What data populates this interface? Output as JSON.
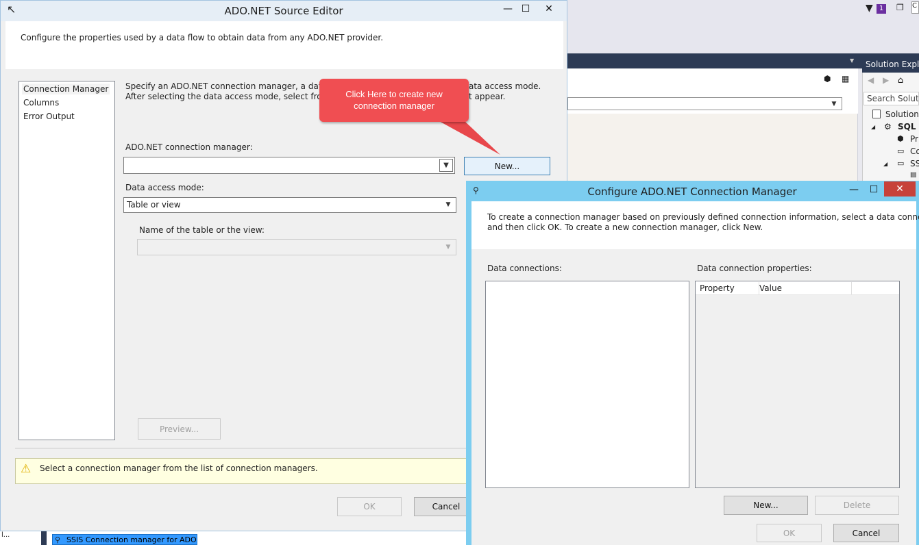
{
  "background_ide": {
    "solution_explorer_title": "Solution Explor",
    "search_placeholder": "Search Solution",
    "tree": [
      "Solution '",
      "SQL S",
      "Pr",
      "Co",
      "SS"
    ],
    "filter_badge": "1",
    "top_right_char": "C",
    "taskbar_item": "SSIS Connection manager for ADO.NET",
    "taskbar_left": "l..."
  },
  "source_editor": {
    "title": "ADO.NET Source Editor",
    "description": "Configure the properties used by a data flow to obtain data from any ADO.NET provider.",
    "nav_items": [
      "Connection Manager",
      "Columns",
      "Error Output"
    ],
    "instructions_line1": "Specify an ADO.NET connection manager, a data sour",
    "instructions_line1_end": "ata access mode.",
    "instructions_line2": "After selecting the data access mode, select from amo",
    "instructions_line2_end": "t appear.",
    "conn_label": "ADO.NET connection manager:",
    "conn_value": "",
    "new_button": "New...",
    "access_label": "Data access mode:",
    "access_value": "Table or view",
    "table_label": "Name of the table or the view:",
    "table_value": "",
    "preview_button": "Preview...",
    "warning": "Select a connection manager from the list of connection managers.",
    "ok_button": "OK",
    "cancel_button": "Cancel"
  },
  "callout": {
    "text_line1": "Click Here to create new",
    "text_line2": "connection manager"
  },
  "conn_dialog": {
    "title": "Configure ADO.NET Connection Manager",
    "desc_line1": "To create a connection manager based on previously defined connection information, select a data connection,",
    "desc_line2": "and then click OK. To create a new connection manager, click New.",
    "data_connections_label": "Data connections:",
    "properties_label": "Data connection properties:",
    "columns": [
      "Property",
      "Value"
    ],
    "new_button": "New...",
    "delete_button": "Delete",
    "ok_button": "OK",
    "cancel_button": "Cancel"
  },
  "colors": {
    "dialog_title_active": "#7ccdf0",
    "callout": "#f04e52",
    "ide_dark": "#2d3b55"
  }
}
